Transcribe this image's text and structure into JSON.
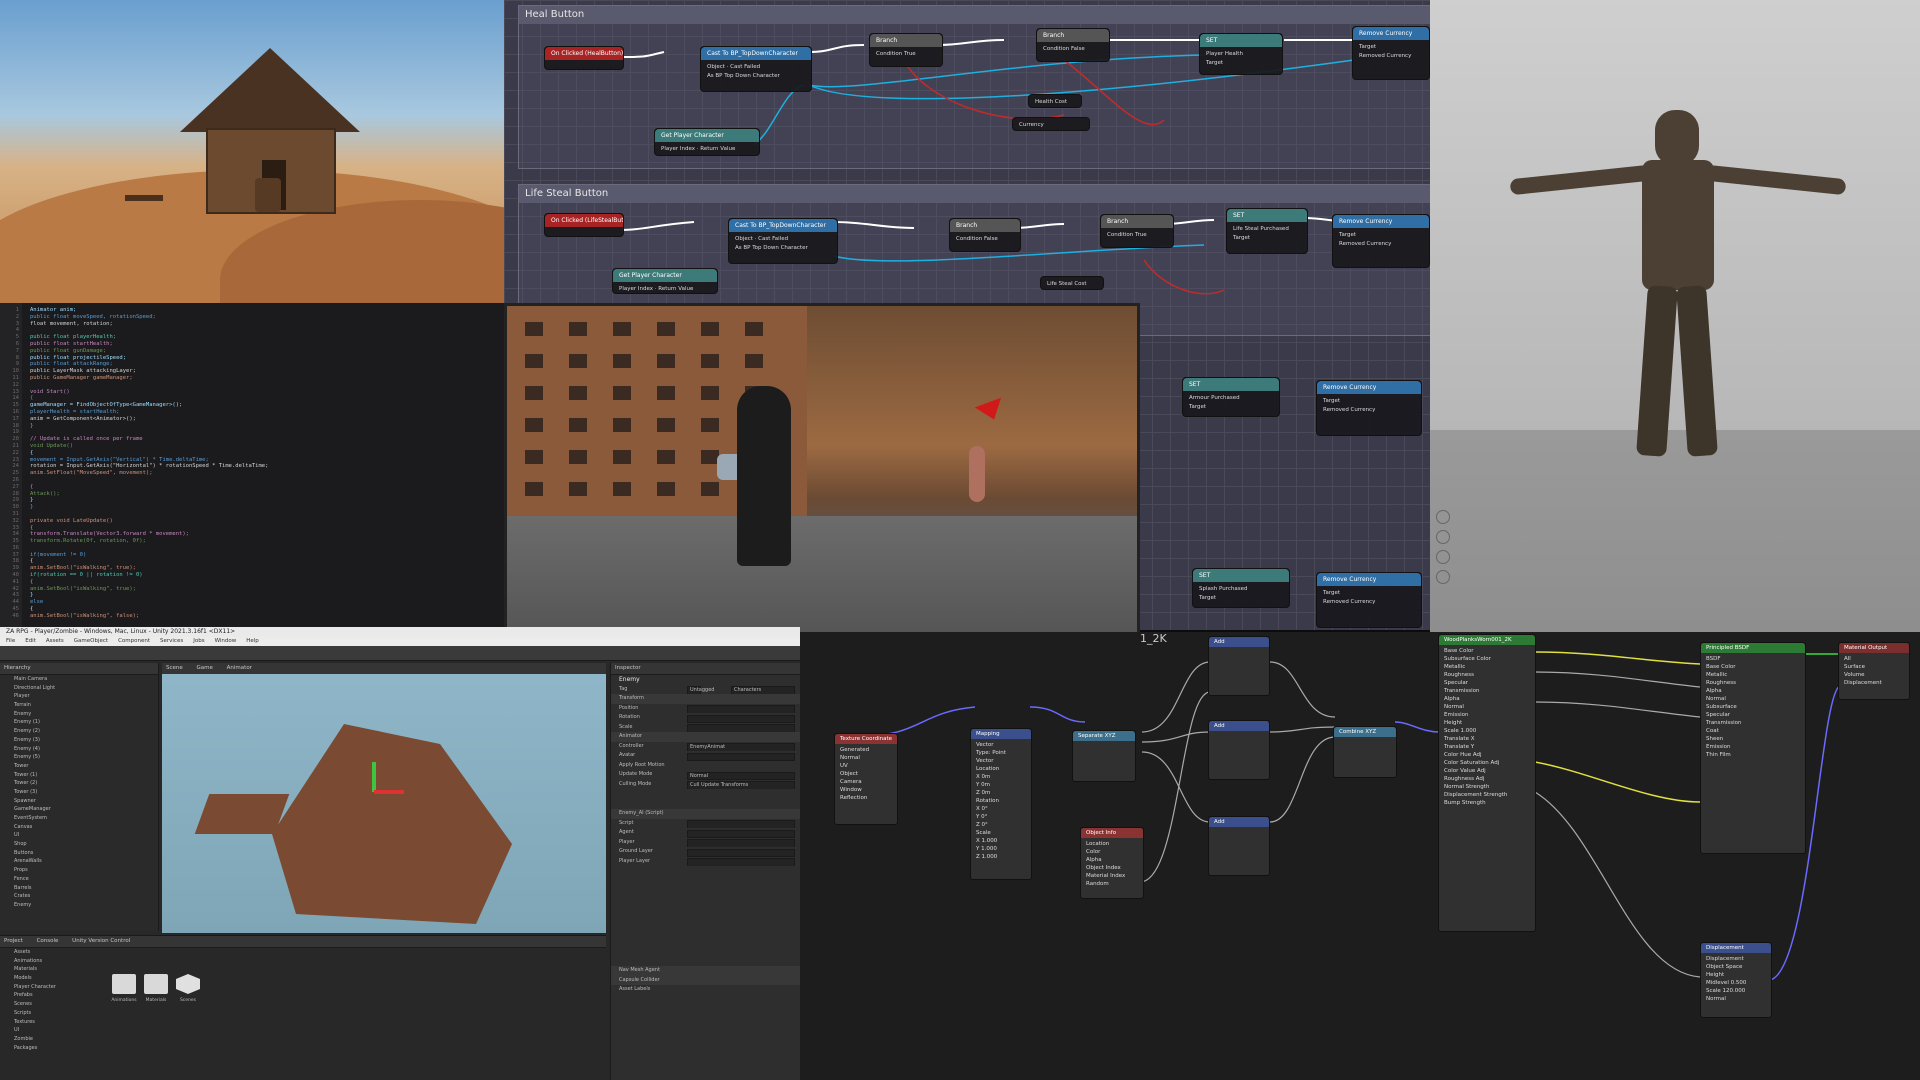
{
  "blueprint": {
    "comment_heal": "Heal Button",
    "comment_lifesteal": "Life Steal Button",
    "nodes": {
      "on_clicked_heal": "On Clicked (HealButton)",
      "cast_1": "Cast To BP_TopDownCharacter",
      "branch_1": "Branch",
      "branch_2": "Branch",
      "set_health": "SET",
      "remove_currency_1": "Remove Currency",
      "get_player_1": "Get Player Character",
      "health_cost": "Health Cost",
      "currency_1": "Currency",
      "on_clicked_ls": "On Clicked (LifeStealButton)",
      "cast_2": "Cast To BP_TopDownCharacter",
      "branch_3": "Branch",
      "branch_4": "Branch",
      "set_ls": "SET",
      "remove_currency_2": "Remove Currency",
      "get_player_2": "Get Player Character",
      "ls_cost": "Life Steal Cost",
      "set_armour": "SET",
      "remove_currency_3": "Remove Currency",
      "set_splash": "SET",
      "remove_currency_4": "Remove Currency"
    },
    "pins": {
      "object": "Object",
      "cast_failed": "Cast Failed",
      "as_bp": "As BP Top Down Character",
      "condition": "Condition",
      "true": "True",
      "false": "False",
      "target": "Target",
      "player_health": "Player Health",
      "removed_currency": "Removed Currency",
      "player_index": "Player Index",
      "return_value": "Return Value",
      "life_steal_purchased": "Life Steal Purchased",
      "armour_purchased": "Armour Purchased",
      "splash_purchased": "Splash Purchased"
    }
  },
  "code": {
    "gutter": [
      "1",
      "2",
      "3",
      "4",
      "5",
      "6",
      "7",
      "8",
      "9",
      "10",
      "11",
      "12",
      "13",
      "14",
      "15",
      "16",
      "17",
      "18",
      "19",
      "20",
      "21",
      "22",
      "23",
      "24",
      "25",
      "26",
      "27",
      "28",
      "29",
      "30",
      "31",
      "32",
      "33",
      "34",
      "35",
      "36",
      "37",
      "38",
      "39",
      "40",
      "41",
      "42",
      "43",
      "44",
      "45",
      "46"
    ],
    "lines": [
      "Animator anim;",
      "public float moveSpeed, rotationSpeed;",
      "float movement, rotation;",
      "",
      "public float playerHealth;",
      "public float startHealth;",
      "public float gunDamage;",
      "public float projectileSpeed;",
      "public float attackRange;",
      "public LayerMask attackingLayer;",
      "public GameManager gameManager;",
      "",
      "void Start()",
      "{",
      "    gameManager = FindObjectOfType<GameManager>();",
      "    playerHealth = startHealth;",
      "    anim = GetComponent<Animator>();",
      "}",
      "",
      "// Update is called once per frame",
      "void Update()",
      "{",
      "    movement = Input.GetAxis(\"Vertical\") * Time.deltaTime;",
      "    rotation = Input.GetAxis(\"Horizontal\") * rotationSpeed * Time.deltaTime;",
      "    anim.SetFloat(\"MoveSpeed\", movement);",
      "",
      "    {",
      "        Attack();",
      "    }",
      "}",
      "",
      "private void LateUpdate()",
      "{",
      "    transform.Translate(Vector3.forward * movement);",
      "    transform.Rotate(0f, rotation, 0f);",
      "",
      "    if(movement != 0)",
      "    {",
      "        anim.SetBool(\"isWalking\", true);",
      "        if(rotation == 0 || rotation != 0)",
      "        {",
      "            anim.SetBool(\"isWalking\", true);",
      "        }",
      "        else",
      "        {",
      "            anim.SetBool(\"isWalking\", false);"
    ]
  },
  "unity": {
    "window_title": "ZA RPG - Player/Zombie - Windows, Mac, Linux - Unity 2021.3.16f1 <DX11>",
    "menu": [
      "File",
      "Edit",
      "Assets",
      "GameObject",
      "Component",
      "Services",
      "Jobs",
      "Window",
      "Help"
    ],
    "hierarchy_tab": "Hierarchy",
    "scene_tabs": [
      "Scene",
      "Game",
      "Animator"
    ],
    "inspector_tab": "Inspector",
    "hierarchy_items": [
      "Main Camera",
      "Directional Light",
      "Player",
      "Terrain",
      "Enemy",
      "Enemy (1)",
      "Enemy (2)",
      "Enemy (3)",
      "Enemy (4)",
      "Enemy (5)",
      "Tower",
      "Tower (1)",
      "Tower (2)",
      "Tower (3)",
      "Spawner",
      "GameManager",
      "EventSystem",
      "Canvas",
      "UI",
      "Shop",
      "Buttons",
      "ArenaWalls",
      "Props",
      "Fence",
      "Barrels",
      "Crates",
      "Enemy"
    ],
    "inspector": {
      "object_name": "Enemy",
      "tag": "Untagged",
      "layer": "Characters",
      "transform": "Transform",
      "position": "Position",
      "rotation": "Rotation",
      "scale": "Scale",
      "animator": "Animator",
      "controller": "Controller",
      "controller_value": "EnemyAnimat",
      "avatar": "Avatar",
      "apply_root_motion": "Apply Root Motion",
      "update_mode": "Update Mode",
      "update_mode_value": "Normal",
      "culling_mode": "Culling Mode",
      "culling_mode_value": "Cull Update Transforms",
      "enemy_ai": "Enemy_AI (Script)",
      "script": "Script",
      "agent": "Agent",
      "player": "Player",
      "ground_layer": "Ground Layer",
      "player_layer": "Player Layer",
      "nav_mesh_agent": "Nav Mesh Agent",
      "capsule_collider": "Capsule Collider",
      "add_component": "Asset Labels"
    },
    "project_tabs": [
      "Project",
      "Console",
      "Unity Version Control"
    ],
    "project_folders": [
      "Animations",
      "Materials",
      "Scenes"
    ],
    "project_tree": [
      "Assets",
      "Animations",
      "Materials",
      "Models",
      "Player Character",
      "Prefabs",
      "Scenes",
      "Scripts",
      "Textures",
      "UI",
      "Zombie",
      "Packages"
    ]
  },
  "shader": {
    "texture_label": "1_2K",
    "nodes": {
      "tex_coord": "Texture Coordinate",
      "mapping": "Mapping",
      "separate": "Separate XYZ",
      "object_info": "Object Info",
      "add1": "Add",
      "add2": "Add",
      "add3": "Add",
      "combine": "Combine XYZ",
      "wood": "WoodPlanksWorn001_2K",
      "principled": "Principled BSDF",
      "material_output": "Material Output",
      "displacement": "Displacement"
    },
    "tex_coord_outputs": [
      "Generated",
      "Normal",
      "UV",
      "Object",
      "Camera",
      "Window",
      "Reflection"
    ],
    "mapping_rows": [
      "Vector",
      "Type: Point",
      "Vector",
      "Location",
      "X 0m",
      "Y 0m",
      "Z 0m",
      "Rotation",
      "X 0°",
      "Y 0°",
      "Z 0°",
      "Scale",
      "X 1.000",
      "Y 1.000",
      "Z 1.000"
    ],
    "object_info_rows": [
      "Location",
      "Color",
      "Alpha",
      "Object Index",
      "Material Index",
      "Random"
    ],
    "wood_rows": [
      "Base Color",
      "Subsurface Color",
      "Metallic",
      "Roughness",
      "Specular",
      "Transmission",
      "Alpha",
      "Normal",
      "Emission",
      "Height",
      "Scale 1.000",
      "Translate X",
      "Translate Y",
      "Color Hue Adj",
      "Color Saturation Adj",
      "Color Value Adj",
      "Roughness Adj",
      "Normal Strength",
      "Displacement Strength",
      "Bump Strength"
    ],
    "principled_rows": [
      "BSDF",
      "Base Color",
      "Metallic",
      "Roughness",
      "Alpha",
      "Normal",
      "Subsurface",
      "Specular",
      "Transmission",
      "Coat",
      "Sheen",
      "Emission",
      "Thin Film"
    ],
    "output_rows": [
      "All",
      "Surface",
      "Volume",
      "Displacement"
    ],
    "displacement_rows": [
      "Displacement",
      "Object Space",
      "Height",
      "Midlevel 0.500",
      "Scale 120.000",
      "Normal"
    ]
  }
}
